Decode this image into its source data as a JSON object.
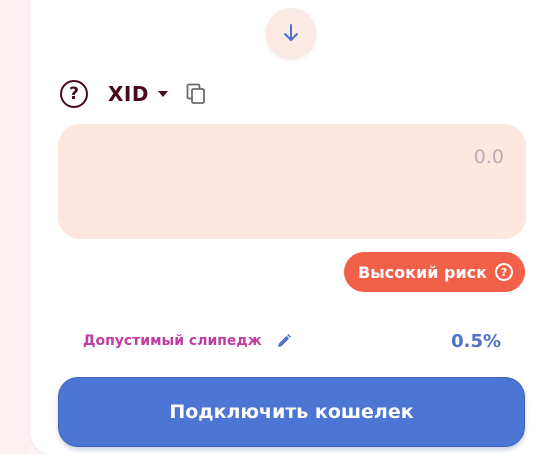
{
  "swap": {
    "direction_icon": "arrow-down-icon"
  },
  "output_token": {
    "help_icon": "question-circle-icon",
    "help_glyph": "?",
    "symbol": "XID",
    "dropdown_icon": "caret-down-icon",
    "copy_icon": "copy-icon",
    "amount_placeholder": "0.0"
  },
  "risk_badge": {
    "label": "Высокий риск",
    "icon": "question-circle-icon",
    "icon_glyph": "?",
    "color": "#f2604a"
  },
  "slippage": {
    "label": "Допустимый слипедж",
    "edit_icon": "pencil-icon",
    "value": "0.5%"
  },
  "connect_button": {
    "label": "Подключить кошелек",
    "color": "#4d76d4"
  },
  "colors": {
    "token_text": "#4a0a1c",
    "slippage_label": "#c03da0",
    "slippage_value": "#4f71cc",
    "input_bg": "#fde7df"
  }
}
